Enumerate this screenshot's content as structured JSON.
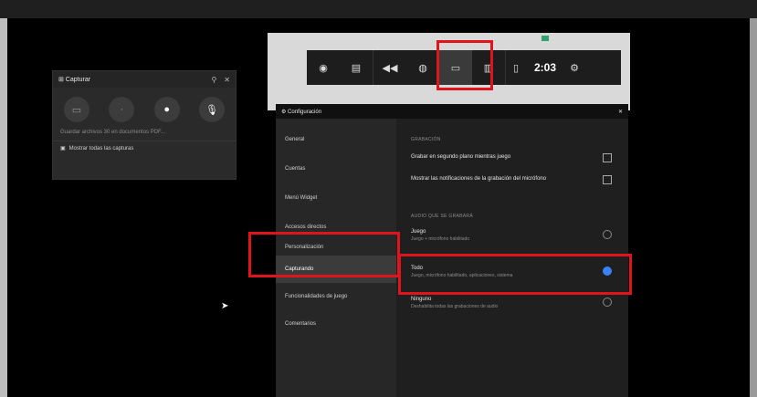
{
  "capture_widget": {
    "title": "⊞ Capturar",
    "pin_icon": "pin-icon",
    "close_icon": "close-icon",
    "buttons": [
      "screenshot-icon",
      "record-last-icon",
      "record-icon",
      "mic-icon"
    ],
    "message": "Guardar archivos 30 en documentos PDF...",
    "show_all": "Mostrar todas las capturas"
  },
  "game_bar": {
    "clock": "2:03"
  },
  "settings": {
    "title": "⚙ Configuración",
    "close": "✕",
    "nav": [
      "General",
      "Cuentas",
      "Menú Widget",
      "Accesos directos",
      "Personalización",
      "Capturando",
      "Funcionalidades de juego",
      "Comentarios"
    ],
    "active_nav": "Capturando",
    "section_recording": "GRABACIÓN",
    "opt1": "Grabar en segundo plano mientras juego",
    "opt2": "Mostrar las notificaciones de la grabación del micrófono",
    "section_audio": "AUDIO QUE SE GRABARÁ",
    "audio_options": [
      {
        "label": "Juego",
        "sub": "Juego + micrófono habilitado",
        "selected": false
      },
      {
        "label": "Todo",
        "sub": "Juego, micrófono habilitado, aplicaciones, sistema",
        "selected": true
      },
      {
        "label": "Ninguno",
        "sub": "Deshabilita todas las grabaciones de audio",
        "selected": false
      }
    ]
  },
  "highlight_color": "#e0141c"
}
